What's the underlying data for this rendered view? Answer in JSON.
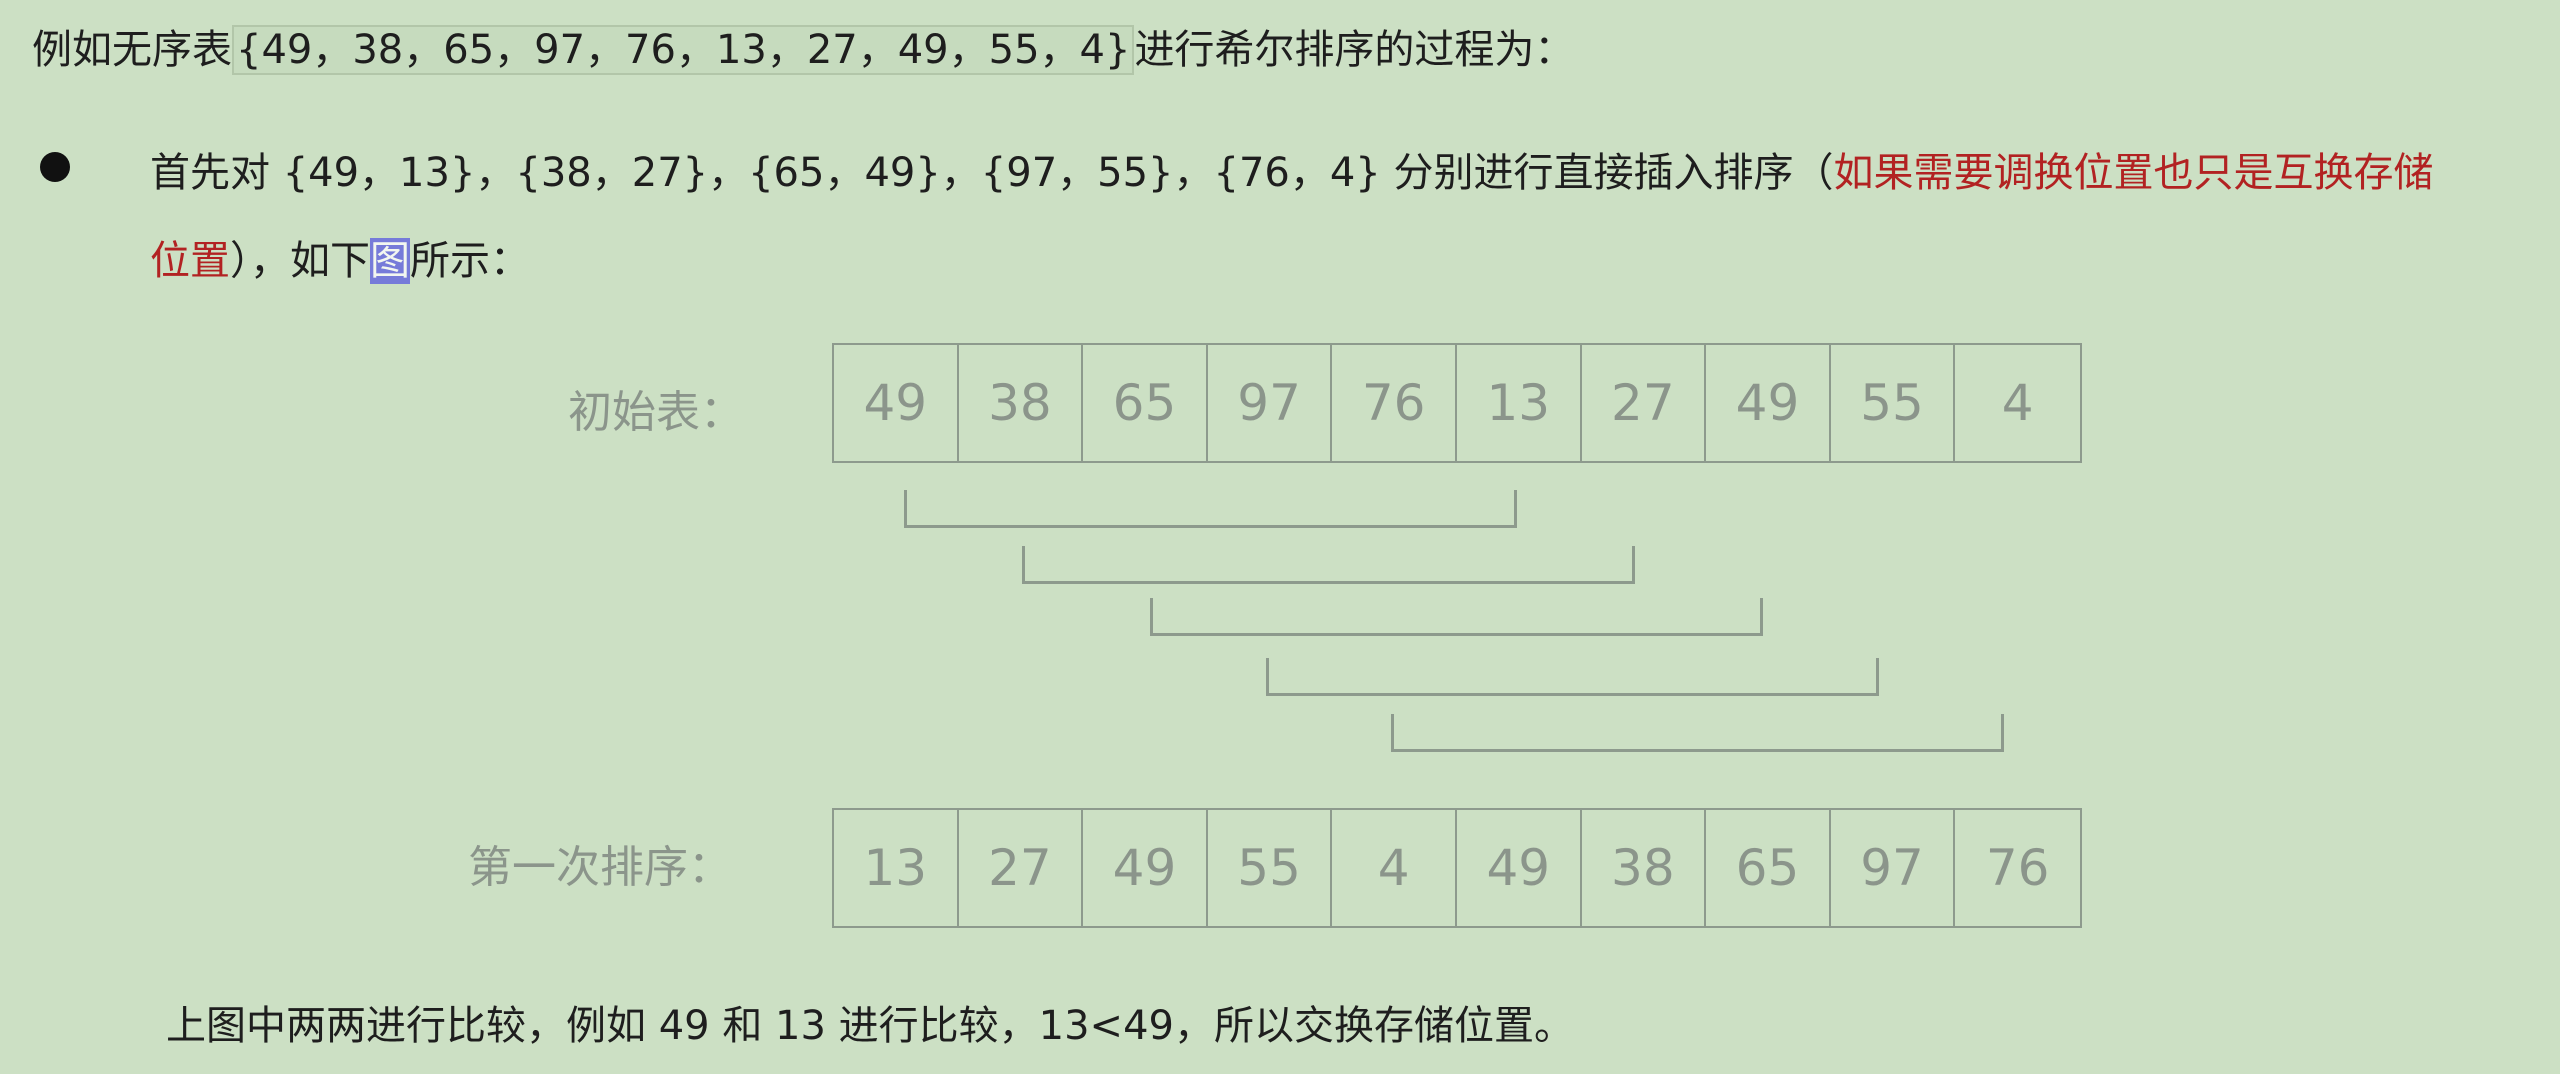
{
  "intro": {
    "prefix": "例如无序表",
    "list": "{49，38，65，97，76，13，27，49，55，4}",
    "suffix": "进行希尔排序的过程为："
  },
  "bullet": {
    "line1_text": "首先对 {49，13}，{38，27}，{65，49}，{97，55}，{76，4} 分别进行直接插入排序（",
    "line1_red": "如果需要调换位置也只是互换存储",
    "line2_red": "位置",
    "line2_text_a": "），如下",
    "line2_highlight": "图",
    "line2_text_b": "所示："
  },
  "diagram": {
    "initial_label": "初始表：",
    "initial_values": [
      "49",
      "38",
      "65",
      "97",
      "76",
      "13",
      "27",
      "49",
      "55",
      "4"
    ],
    "first_label": "第一次排序：",
    "first_values": [
      "13",
      "27",
      "49",
      "55",
      "4",
      "49",
      "38",
      "65",
      "97",
      "76"
    ],
    "pair_gap": 5
  },
  "conclusion": "上图中两两进行比较，例如 49 和 13 进行比较，13<49，所以交换存储位置。"
}
